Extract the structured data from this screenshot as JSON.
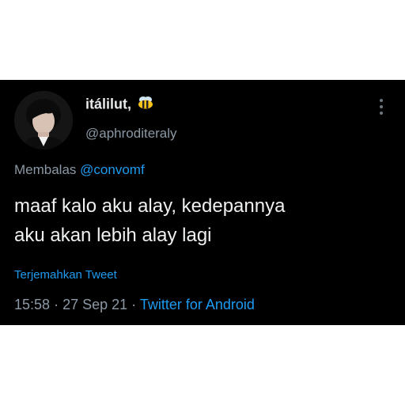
{
  "tweet": {
    "display_name": "itálilut,",
    "name_emoji": "bee-emoji",
    "handle": "@aphroditeraly",
    "reply_prefix": "Membalas",
    "reply_to": "@convomf",
    "text_line1": "maaf kalo aku alay, kedepannya",
    "text_line2": "aku akan lebih alay lagi",
    "translate_label": "Terjemahkan Tweet",
    "time": "15:58",
    "separator": "·",
    "date": "27 Sep 21",
    "source": "Twitter for Android"
  },
  "icons": {
    "more": "more-vertical-icon"
  },
  "colors": {
    "background": "#000000",
    "accent": "#1d9bf0",
    "secondary_text": "#8b98a5",
    "primary_text": "#e7e9ea"
  }
}
